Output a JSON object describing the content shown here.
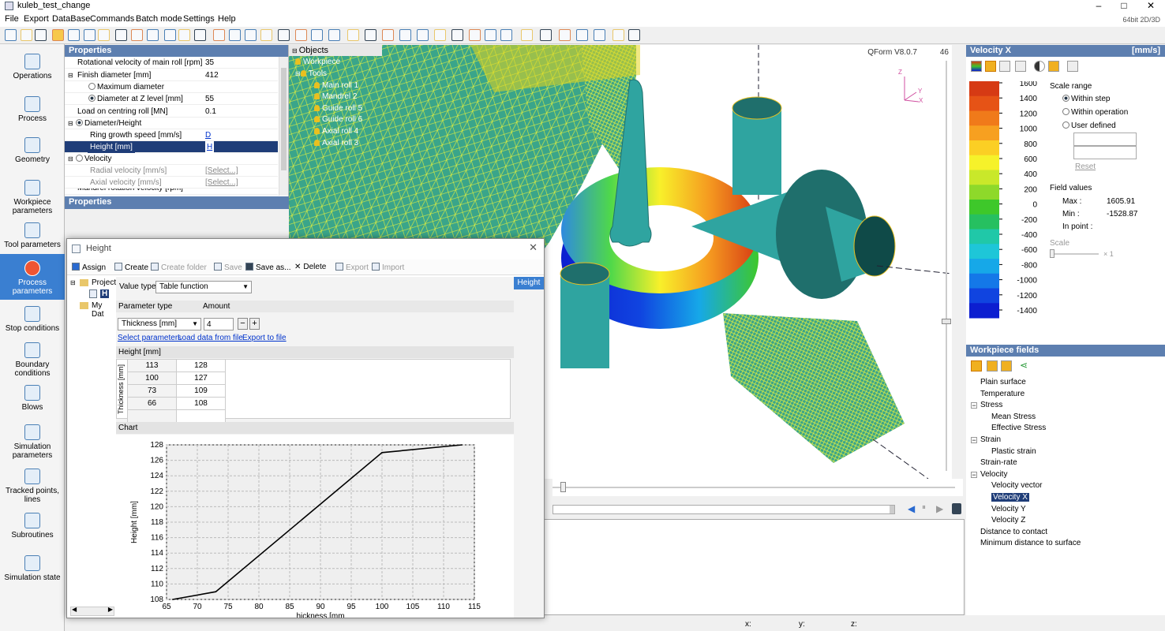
{
  "app": {
    "title": "kuleb_test_change",
    "version_label": "64bit 2D/3D"
  },
  "window_buttons": {
    "minimize": "–",
    "maximize": "□",
    "close": "✕"
  },
  "menu": [
    "File",
    "Export",
    "DataBase",
    "Commands",
    "Batch mode",
    "Settings",
    "Help"
  ],
  "nav": [
    {
      "label": "Operations",
      "icon": "operations-icon"
    },
    {
      "label": "Process",
      "icon": "process-icon"
    },
    {
      "label": "Geometry",
      "icon": "geometry-icon"
    },
    {
      "label": "Workpiece parameters",
      "icon": "workpiece-icon"
    },
    {
      "label": "Tool parameters",
      "icon": "tool-icon"
    },
    {
      "label": "Process parameters",
      "icon": "process-parameters-icon",
      "active": true
    },
    {
      "label": "Stop conditions",
      "icon": "traffic-light-icon"
    },
    {
      "label": "Boundary conditions",
      "icon": "boundary-icon"
    },
    {
      "label": "Blows",
      "icon": "blows-icon"
    },
    {
      "label": "Simulation parameters",
      "icon": "simulation-parameters-icon"
    },
    {
      "label": "Tracked points, lines",
      "icon": "tracked-points-icon"
    },
    {
      "label": "Subroutines",
      "icon": "fx-icon"
    },
    {
      "label": "Simulation state",
      "icon": "simulation-state-icon"
    }
  ],
  "properties": {
    "header": "Properties",
    "rows": [
      {
        "key": "Rotational velocity of main roll [rpm]",
        "value": "35"
      },
      {
        "key": "Finish diameter [mm]",
        "value": "412"
      },
      {
        "key": "Maximum diameter",
        "value": ""
      },
      {
        "key": "Diameter at Z level [mm]",
        "value": "55"
      },
      {
        "key": "Load on centring roll [MN]",
        "value": "0.1"
      },
      {
        "key": "Diameter/Height",
        "value": ""
      },
      {
        "key": "Ring growth speed [mm/s]",
        "value": "D"
      },
      {
        "key": "Height [mm]",
        "value": "H"
      },
      {
        "key": "Velocity",
        "value": ""
      },
      {
        "key": "Radial velocity [mm/s]",
        "value": "[Select...]"
      },
      {
        "key": "Axial velocity [mm/s]",
        "value": "[Select...]"
      },
      {
        "key": "Mandrel rotation velocity [rpm]",
        "value": ""
      }
    ],
    "header2": "Properties"
  },
  "objects": {
    "header": "Objects",
    "items": [
      "Workpiece",
      "Tools",
      "Main roll 1",
      "Mandrel 2",
      "Guide roll 5",
      "Guide roll 6",
      "Axial roll 4",
      "Axial roll 3"
    ]
  },
  "viewport": {
    "product_label": "QForm V8.0.7",
    "step_number": "46",
    "axes": {
      "x": "X",
      "y": "Y",
      "z": "Z"
    }
  },
  "velocity_panel": {
    "title": "Velocity X",
    "unit": "[mm/s]",
    "scale_labels": [
      "1600",
      "1400",
      "1200",
      "1000",
      "800",
      "600",
      "400",
      "200",
      "0",
      "-200",
      "-400",
      "-600",
      "-800",
      "-1000",
      "-1200",
      "-1400"
    ],
    "colors": [
      "#d63a14",
      "#e65316",
      "#f07a1a",
      "#f7a020",
      "#fbcf24",
      "#f6f22a",
      "#c9e82a",
      "#8ed92a",
      "#3ec82a",
      "#26c060",
      "#20c8a8",
      "#1ec6d8",
      "#16a8e8",
      "#1478e8",
      "#1044e0",
      "#0c1ed0"
    ],
    "scale_range": "Scale range",
    "options": [
      "Within step",
      "Within operation",
      "User defined"
    ],
    "reset": "Reset",
    "field_values": "Field values",
    "max_label": "Max :",
    "max": "1605.91",
    "min_label": "Min :",
    "min": "-1528.87",
    "in_point": "In point :",
    "scale": "Scale",
    "scale_factor": "× 1"
  },
  "workpiece_fields": {
    "title": "Workpiece fields",
    "items": [
      "Plain surface",
      "Temperature",
      "Stress",
      "Mean Stress",
      "Effective Stress",
      "Strain",
      "Plastic strain",
      "Strain-rate",
      "Velocity",
      "Velocity vector",
      "Velocity X",
      "Velocity Y",
      "Velocity Z",
      "Distance to contact",
      "Minimum distance to surface"
    ]
  },
  "dialog": {
    "title": "Height",
    "toolbar": {
      "assign": "Assign",
      "create": "Create",
      "create_folder": "Create folder",
      "save": "Save",
      "save_as": "Save as...",
      "delete": "Delete",
      "export": "Export",
      "import": "Import"
    },
    "tree": {
      "project": "Project",
      "item": "H",
      "mydb": "My Dat"
    },
    "tab": "Height",
    "value_type_label": "Value type",
    "value_type": "Table function",
    "param_type_label": "Parameter type",
    "amount_label": "Amount",
    "param_type": "Thickness [mm]",
    "amount": "4",
    "links": {
      "select": "Select parameters",
      "load": "Load data from file",
      "export": "Export to file"
    },
    "table_header": "Height [mm]",
    "row_axis": "Thickness [mm]",
    "chart_header": "Chart"
  },
  "statusbar": {
    "x": "x:",
    "y": "y:",
    "z": "z:"
  },
  "chart_data": {
    "type": "line",
    "x": [
      66,
      73,
      100,
      113
    ],
    "y": [
      108,
      109,
      127,
      128
    ],
    "xlabel": "hickness [mm",
    "ylabel": "Height [mm]",
    "xlim": [
      65,
      115
    ],
    "ylim": [
      108,
      128
    ],
    "xticks": [
      65,
      70,
      75,
      80,
      85,
      90,
      95,
      100,
      105,
      110,
      115
    ],
    "yticks": [
      108,
      110,
      112,
      114,
      116,
      118,
      120,
      122,
      124,
      126,
      128
    ],
    "grid": true
  }
}
